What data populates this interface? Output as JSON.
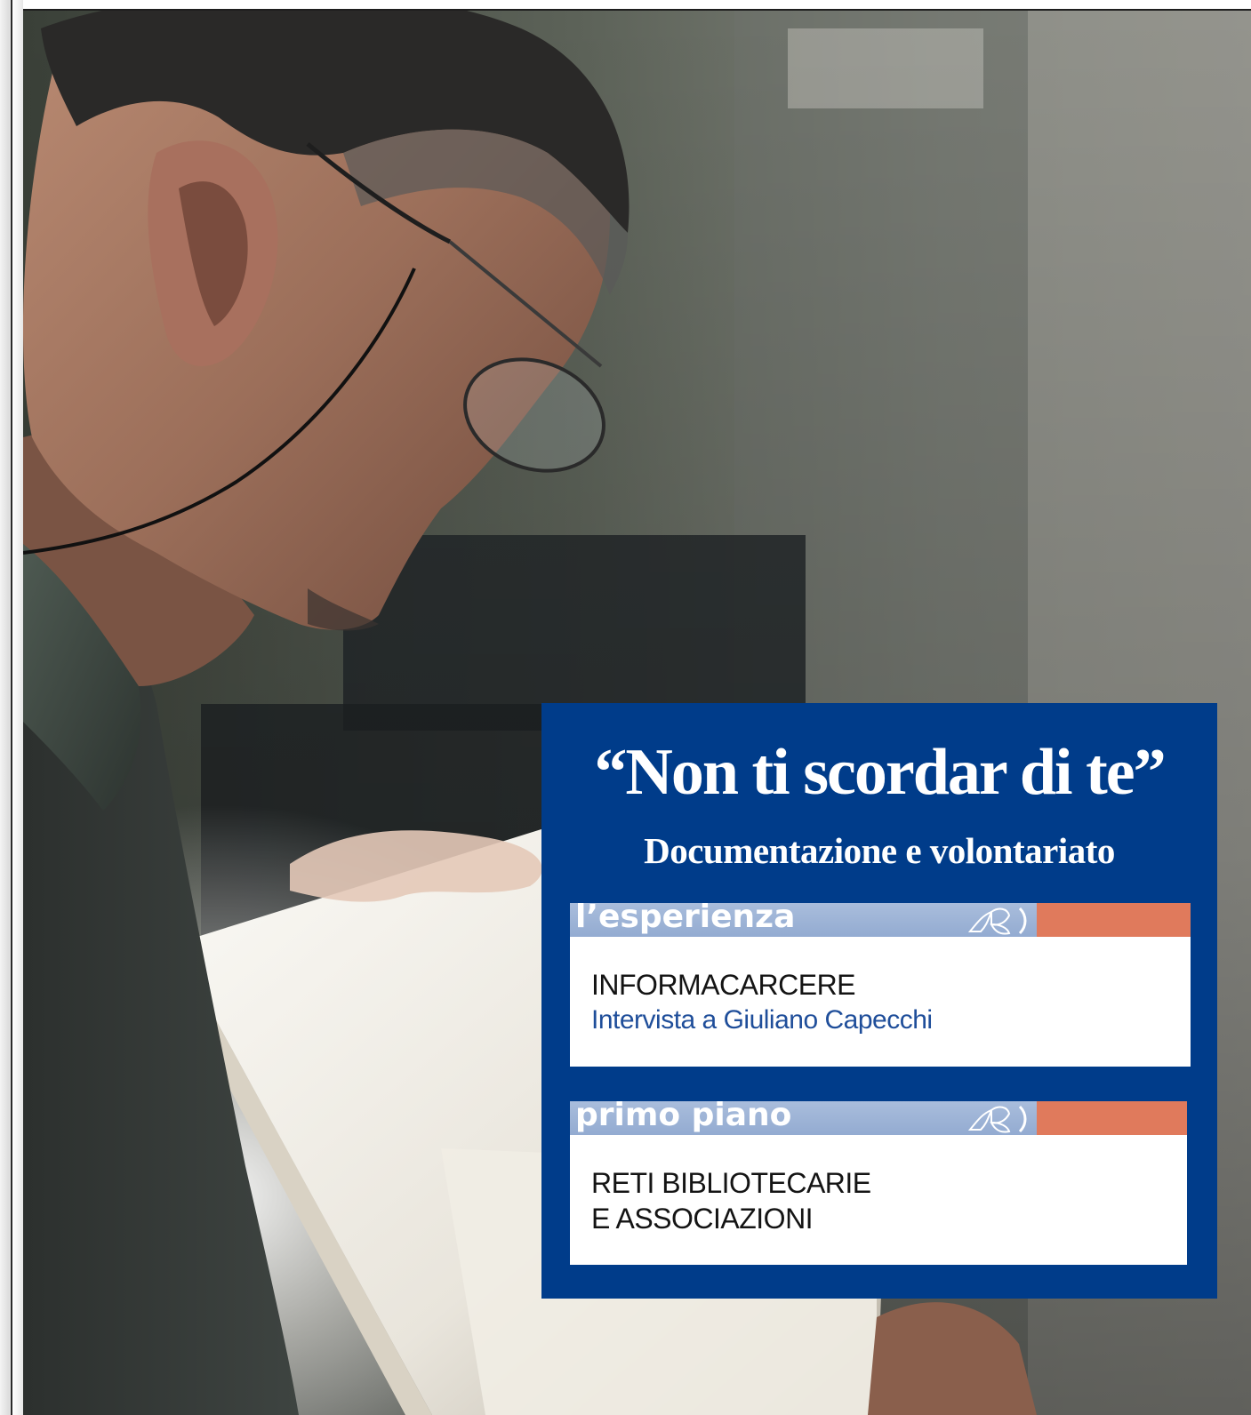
{
  "cover": {
    "title": "“Non ti scordar di te”",
    "subtitle": "Documentazione e volontariato"
  },
  "sections": [
    {
      "label": "l’esperienza",
      "heading": "INFORMACARCERE",
      "subheading": "Intervista a Giuliano Capecchi",
      "icon": "butterfly-icon"
    },
    {
      "label": "primo piano",
      "heading_lines": [
        "RETI BIBLIOTECARIE",
        "E ASSOCIAZIONI"
      ],
      "icon": "butterfly-icon"
    }
  ],
  "photo": {
    "description_icon": "man-reading-book-photo"
  },
  "colors": {
    "box_blue": "#003c8a",
    "bar_light_blue": "#93abd1",
    "bar_accent_orange": "#e07a5c",
    "subheading_blue": "#1f4e9a"
  }
}
